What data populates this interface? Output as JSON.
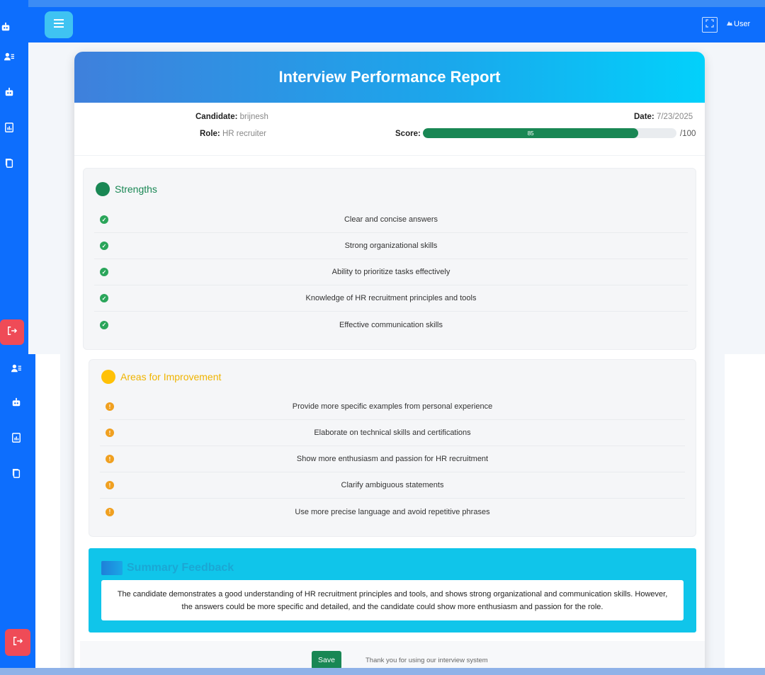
{
  "topbar": {
    "user_label": "User"
  },
  "report": {
    "title": "Interview Performance Report",
    "candidate_label": "Candidate:",
    "candidate": "brijnesh",
    "role_label": "Role:",
    "role": "HR recruiter",
    "date_label": "Date:",
    "date": "7/23/2025",
    "score_label": "Score:",
    "score": "85",
    "score_fraction": 0.85,
    "score_max": "/100"
  },
  "strengths": {
    "title": "Strengths",
    "color": "#198754",
    "items": [
      "Clear and concise answers",
      "Strong organizational skills",
      "Ability to prioritize tasks effectively",
      "Knowledge of HR recruitment principles and tools",
      "Effective communication skills"
    ]
  },
  "improvements": {
    "title": "Areas for Improvement",
    "color": "#ffc107",
    "items": [
      "Provide more specific examples from personal experience",
      "Elaborate on technical skills and certifications",
      "Show more enthusiasm and passion for HR recruitment",
      "Clarify ambiguous statements",
      "Use more precise language and avoid repetitive phrases"
    ]
  },
  "summary": {
    "title": "Summary Feedback",
    "text": "The candidate demonstrates a good understanding of HR recruitment principles and tools, and shows strong organizational and communication skills. However, the answers could be more specific and detailed, and the candidate could show more enthusiasm and passion for the role."
  },
  "footer": {
    "save_label": "Save",
    "thanks": "Thank you for using our interview system"
  },
  "icons": {
    "sidebar": [
      "robot-icon",
      "user-list-icon",
      "robot-icon",
      "report-icon",
      "copy-icon",
      "logout-icon"
    ],
    "strength_item": "check-shield-icon",
    "improvement_item": "exclamation-icon"
  }
}
